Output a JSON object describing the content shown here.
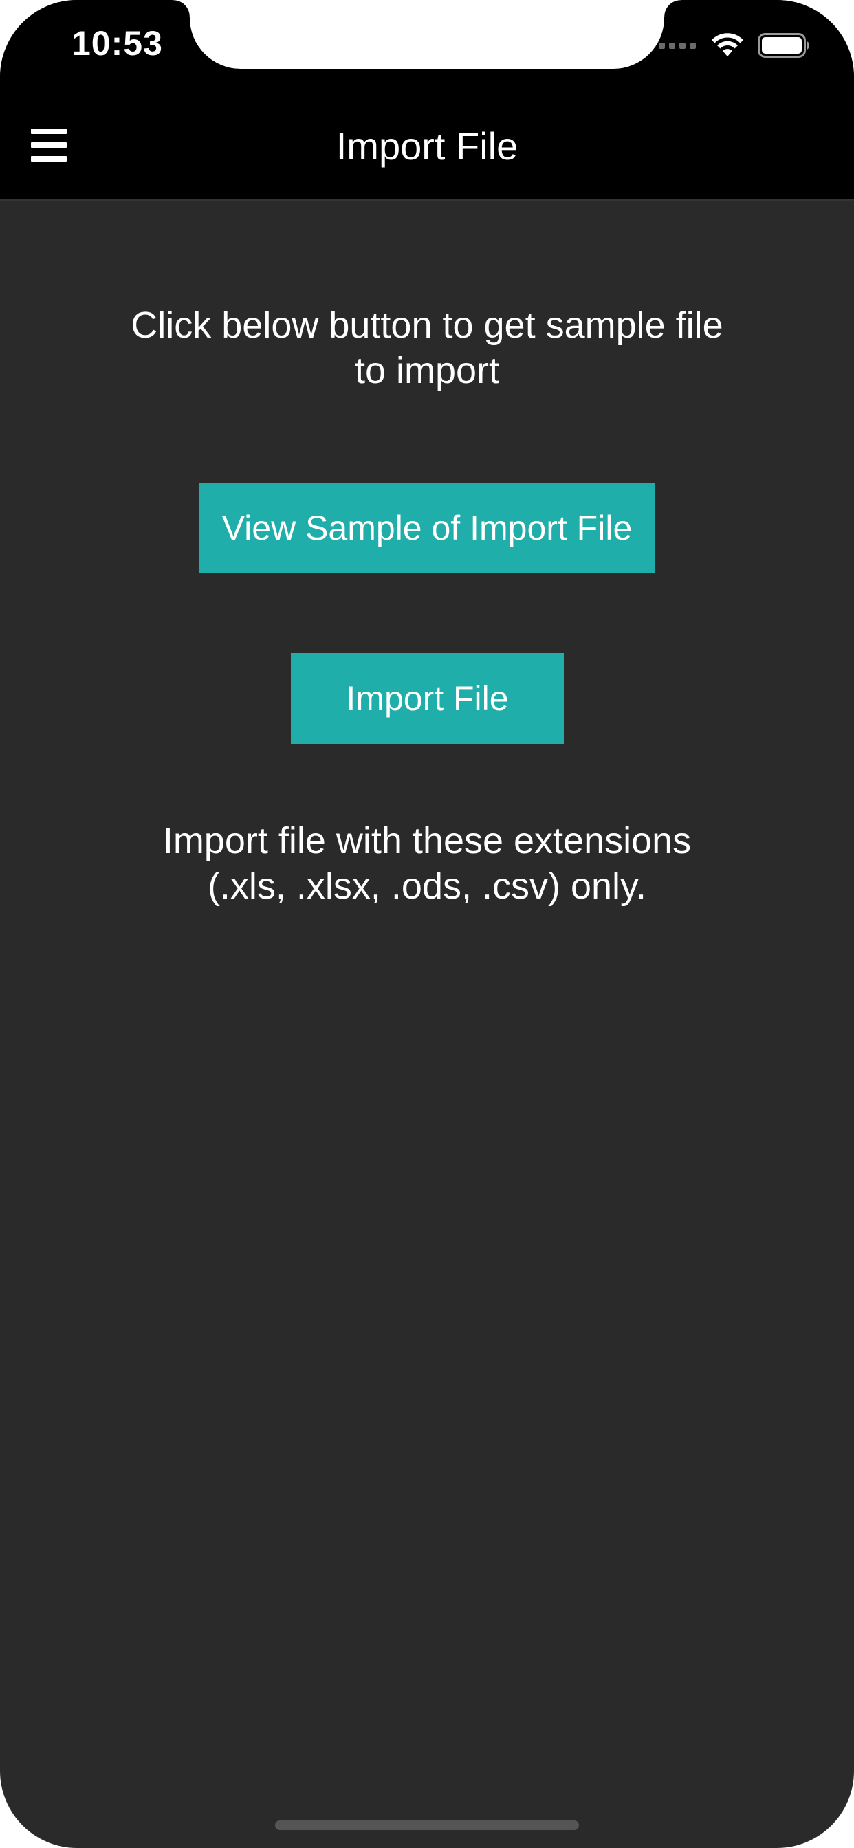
{
  "status_bar": {
    "time": "10:53",
    "icons": [
      "signal-dots-icon",
      "wifi-icon",
      "battery-icon"
    ]
  },
  "nav_bar": {
    "menu_icon": "hamburger-menu-icon",
    "title": "Import File"
  },
  "main": {
    "instruction_line1": "Click below button to get sample file",
    "instruction_line2": "to import",
    "sample_button_label": "View Sample of Import File",
    "import_button_label": "Import File",
    "note_line1": "Import file with these extensions",
    "note_line2": "(.xls, .xlsx, .ods, .csv) only."
  },
  "colors": {
    "accent": "#20aeaa",
    "background": "#2a2a2a",
    "bar": "#000000",
    "text": "#ffffff"
  }
}
